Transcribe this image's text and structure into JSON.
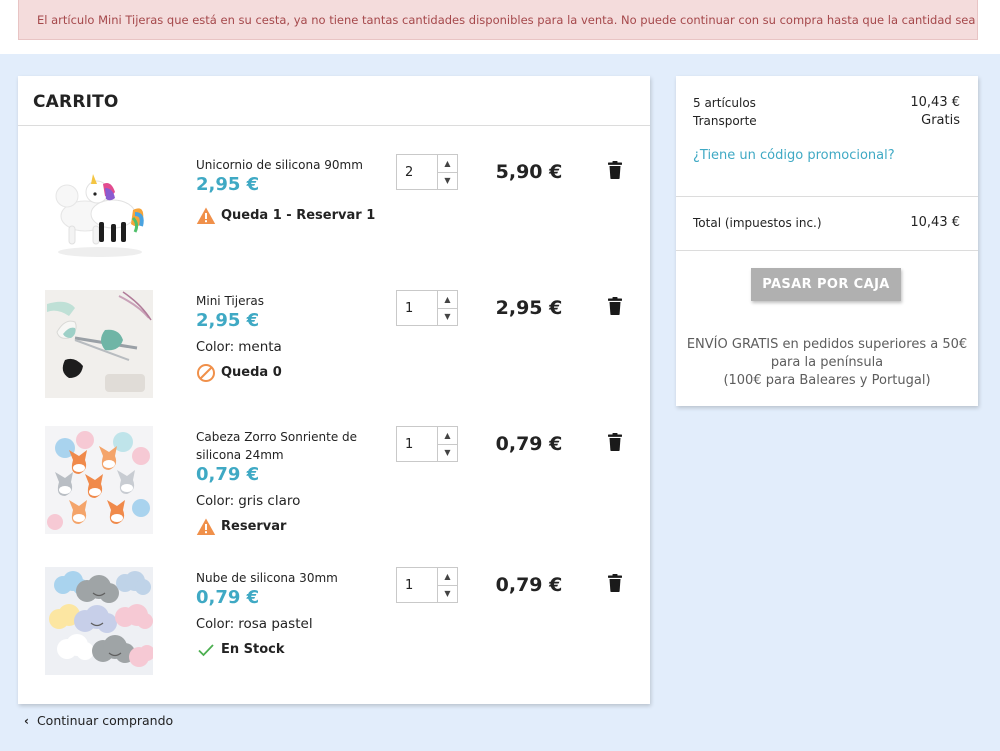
{
  "alert": {
    "message": "El artículo Mini Tijeras que está en su cesta, ya no tiene tantas cantidades disponibles para la venta. No puede continuar con su compra hasta que la cantidad sea ajustada."
  },
  "cart": {
    "title": "CARRITO",
    "items": [
      {
        "name": "Unicornio de silicona 90mm",
        "price": "2,95 €",
        "attr_label": "",
        "attr_value": "",
        "quantity": "2",
        "line_total": "5,90 €",
        "stock_text": "Queda 1 - Reservar 1",
        "stock_icon": "warning-triangle-icon"
      },
      {
        "name": "Mini Tijeras",
        "price": "2,95 €",
        "attr_label": "Color:",
        "attr_value": "menta",
        "quantity": "1",
        "line_total": "2,95 €",
        "stock_text": "Queda 0",
        "stock_icon": "prohibited-icon"
      },
      {
        "name": "Cabeza Zorro Sonriente de silicona 24mm",
        "price": "0,79 €",
        "attr_label": "Color:",
        "attr_value": "gris claro",
        "quantity": "1",
        "line_total": "0,79 €",
        "stock_text": "Reservar",
        "stock_icon": "warning-triangle-icon"
      },
      {
        "name": "Nube de silicona 30mm",
        "price": "0,79 €",
        "attr_label": "Color:",
        "attr_value": "rosa pastel",
        "quantity": "1",
        "line_total": "0,79 €",
        "stock_text": "En Stock",
        "stock_icon": "checkmark-icon"
      }
    ],
    "continue_label": "Continuar comprando"
  },
  "summary": {
    "items_label": "5 artículos",
    "items_value": "10,43 €",
    "shipping_label": "Transporte",
    "shipping_value": "Gratis",
    "promo_link": "¿Tiene un código promocional?",
    "total_label": "Total (impuestos inc.)",
    "total_value": "10,43 €",
    "checkout_label": "PASAR POR CAJA",
    "shipping_note_1": "ENVÍO GRATIS en pedidos superiores a 50€",
    "shipping_note_2": "para la península",
    "shipping_note_3": "(100€ para Baleares y Portugal)"
  },
  "colors": {
    "page_bg": "#e2edfb",
    "price_accent": "#3fa9c4",
    "alert_bg": "#f4dcdc",
    "alert_text": "#a5484b",
    "warning": "#f0904a",
    "success": "#4caf50",
    "checkout_bg": "#b0b0b0"
  }
}
